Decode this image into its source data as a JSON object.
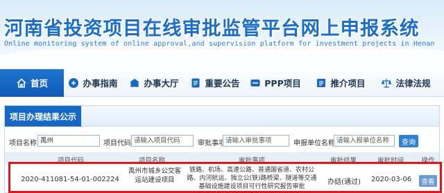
{
  "header": {
    "title": "河南省投资项目在线审批监管平台网上申报系统",
    "subtitle": "Online monitoring system of online approval,and supervision platform for investment projects in Henan"
  },
  "nav": {
    "items": [
      {
        "label": "首页",
        "icon": "home-icon"
      },
      {
        "label": "办事指南",
        "icon": "guide-icon"
      },
      {
        "label": "办事大厅",
        "icon": "hall-icon"
      },
      {
        "label": "重要公告",
        "icon": "announcement-icon"
      },
      {
        "label": "PPP项目",
        "icon": "ppp-icon"
      },
      {
        "label": "推介项目",
        "icon": "promote-icon"
      },
      {
        "label": "法律法规",
        "icon": "law-icon"
      }
    ]
  },
  "panel": {
    "title": "项目办理结果公示",
    "filters": {
      "project_name_label": "项目名称:",
      "project_name_value": "禹州",
      "project_code_label": "项目代码:",
      "project_code_placeholder": "请输入项目代码",
      "approval_item_label": "审批事项:",
      "approval_item_placeholder": "请输入审批事项",
      "applicant_label": "申报单位名称:",
      "applicant_placeholder": "请输入报单位名称",
      "search_label": "查询"
    },
    "table": {
      "headers": [
        "项目代码",
        "项目名称",
        "审批事项",
        "审批结果",
        "审批时间",
        "操作"
      ],
      "row": {
        "code": "2020-411081-54-01-002224",
        "name": "禹州市城乡公交客运站建设项目",
        "approval": "铁路、机场、高速公路、普通国省道、农村公路、内河航运、独立公(铁)路桥梁、隧道等交通基础设施建设项目可行性研究报告审批",
        "result": "办结(通过)",
        "date": "2020-03-06",
        "action": "查看"
      }
    }
  },
  "colors": {
    "brand_blue": "#1668c6",
    "highlight_red": "#e0151c"
  }
}
